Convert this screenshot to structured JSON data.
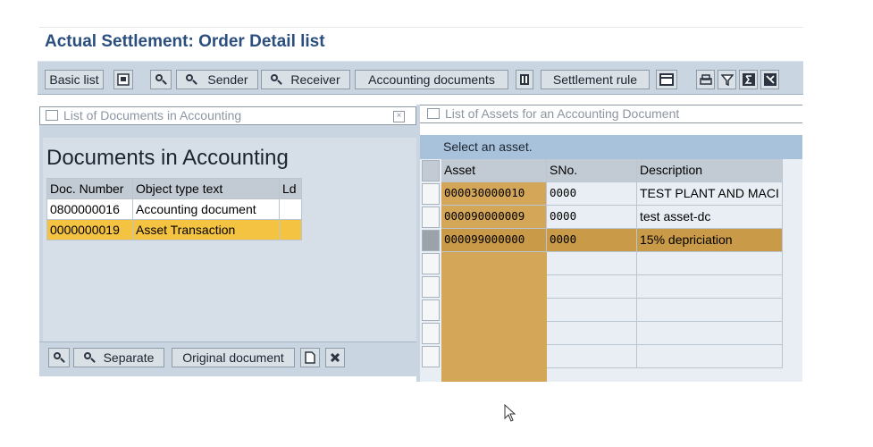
{
  "page": {
    "title": "Actual Settlement: Order Detail list"
  },
  "toolbar": {
    "basic_list": "Basic list",
    "sender": "Sender",
    "receiver": "Receiver",
    "accounting_documents": "Accounting documents",
    "settlement_rule": "Settlement rule"
  },
  "left_panel": {
    "title": "List of Documents in Accounting",
    "heading": "Documents in Accounting",
    "columns": [
      "Doc. Number",
      "Object type text",
      "Ld"
    ],
    "rows": [
      [
        "0800000016",
        "Accounting document",
        ""
      ],
      [
        "0000000019",
        "Asset Transaction",
        ""
      ]
    ],
    "buttons": {
      "separate": "Separate",
      "original_document": "Original document"
    }
  },
  "right_panel": {
    "title": "List of Assets for an Accounting Document",
    "instruction": "Select an asset.",
    "columns": [
      "Asset",
      "SNo.",
      "Description"
    ],
    "rows": [
      [
        "000030000010",
        "0000",
        "TEST PLANT AND MACI"
      ],
      [
        "000090000009",
        "0000",
        "test asset-dc"
      ],
      [
        "000099000000",
        "0000",
        "15% depriciation"
      ]
    ]
  },
  "colors": {
    "title_blue": "#2a4f7e",
    "selected_row": "#f5c342",
    "asset_column": "#d4a657",
    "selected_asset_row": "#c99a48"
  }
}
